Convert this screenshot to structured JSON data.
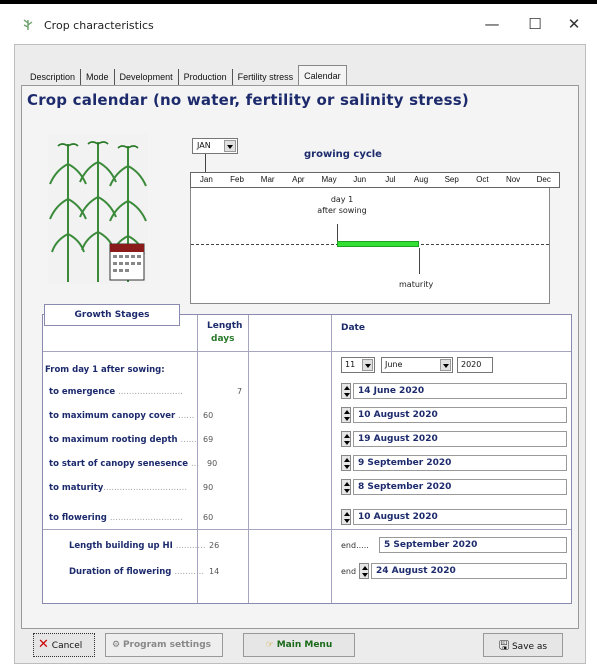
{
  "window": {
    "title": "Crop characteristics",
    "minimize": "—",
    "maximize": "☐",
    "close": "✕"
  },
  "tabs": [
    "Description",
    "Mode",
    "Development",
    "Production",
    "Fertility stress",
    "Calendar"
  ],
  "heading": "Crop calendar (no water, fertility or salinity stress)",
  "month_select": "JAN",
  "growing_cycle": "growing cycle",
  "months": [
    "Jan",
    "Feb",
    "Mar",
    "Apr",
    "May",
    "Jun",
    "Jul",
    "Aug",
    "Sep",
    "Oct",
    "Nov",
    "Dec"
  ],
  "day1_label": "day 1",
  "after_sowing": "after sowing",
  "maturity_label": "maturity",
  "stages": {
    "button": "Growth Stages",
    "length_header": "Length",
    "days_header": "days",
    "date_header": "Date",
    "from_day1": "From day 1 after sowing:",
    "sow_day": "11",
    "sow_month": "June",
    "sow_year": "2020",
    "rows": [
      {
        "label": "to emergence",
        "dots": "........................",
        "value": "7",
        "date": "14 June 2020"
      },
      {
        "label": "to maximum canopy cover",
        "dots": "......",
        "value": "60",
        "date": "10 August 2020"
      },
      {
        "label": "to maximum rooting depth",
        "dots": "......",
        "value": "69",
        "date": "19 August 2020"
      },
      {
        "label": "to start of canopy senesence",
        "dots": "...",
        "value": "90",
        "date": "9 September 2020"
      },
      {
        "label": "to maturity",
        "dots": "...............................",
        "value": "90",
        "date": "8 September 2020"
      },
      {
        "label": "to flowering",
        "dots": "...........................",
        "value": "60",
        "date": "10 August 2020"
      },
      {
        "label": "Length building up HI",
        "dots": "...........",
        "value": "26",
        "end": "end.....",
        "date": "5 September 2020"
      },
      {
        "label": "Duration of flowering",
        "dots": "...........",
        "value": "14",
        "end": "end",
        "date": "24 August 2020"
      }
    ]
  },
  "buttons": {
    "cancel": "Cancel",
    "program_settings": "Program settings",
    "main_menu": "Main Menu",
    "save_as": "Save as"
  }
}
